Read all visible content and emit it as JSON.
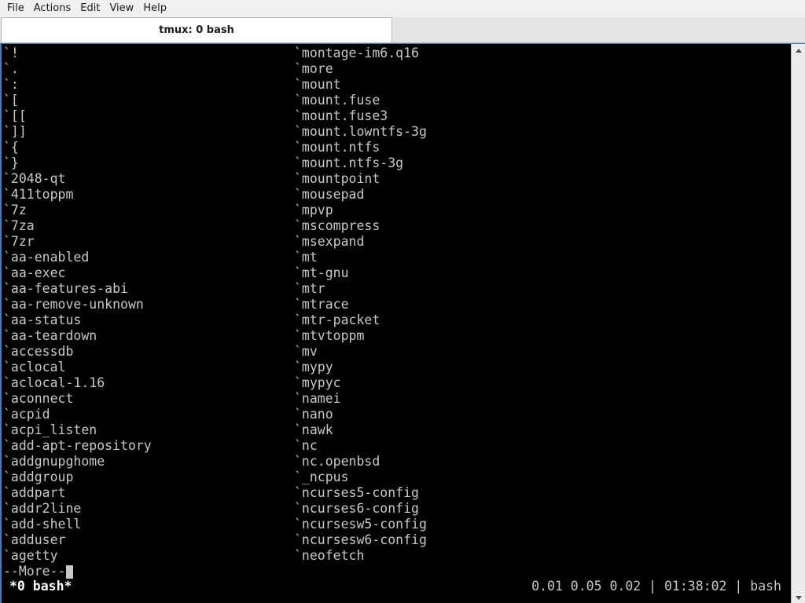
{
  "menubar": {
    "items": [
      "File",
      "Actions",
      "Edit",
      "View",
      "Help"
    ]
  },
  "tab": {
    "title": "tmux: 0 bash"
  },
  "terminal": {
    "left_column": [
      "`!",
      "`.",
      "`:",
      "`[",
      "`[[",
      "`]]",
      "`{",
      "`}",
      "`2048-qt",
      "`411toppm",
      "`7z",
      "`7za",
      "`7zr",
      "`aa-enabled",
      "`aa-exec",
      "`aa-features-abi",
      "`aa-remove-unknown",
      "`aa-status",
      "`aa-teardown",
      "`accessdb",
      "`aclocal",
      "`aclocal-1.16",
      "`aconnect",
      "`acpid",
      "`acpi_listen",
      "`add-apt-repository",
      "`addgnupghome",
      "`addgroup",
      "`addpart",
      "`addr2line",
      "`add-shell",
      "`adduser",
      "`agetty"
    ],
    "right_column": [
      "`montage-im6.q16",
      "`more",
      "`mount",
      "`mount.fuse",
      "`mount.fuse3",
      "`mount.lowntfs-3g",
      "`mount.ntfs",
      "`mount.ntfs-3g",
      "`mountpoint",
      "`mousepad",
      "`mpvp",
      "`mscompress",
      "`msexpand",
      "`mt",
      "`mt-gnu",
      "`mtr",
      "`mtrace",
      "`mtr-packet",
      "`mtvtoppm",
      "`mv",
      "`mypy",
      "`mypyc",
      "`namei",
      "`nano",
      "`nawk",
      "`nc",
      "`nc.openbsd",
      "`_ncpus",
      "`ncurses5-config",
      "`ncurses6-config",
      "`ncursesw5-config",
      "`ncursesw6-config",
      "`neofetch"
    ],
    "pager_prompt": "--More--"
  },
  "status_bar": {
    "window_label": "*0 bash*",
    "right_text": "0.01 0.05 0.02 | 01:38:02 | bash"
  },
  "colors": {
    "terminal_bg": "#000000",
    "terminal_fg": "#c8c8c8",
    "focus_border": "#3c7fc1"
  }
}
